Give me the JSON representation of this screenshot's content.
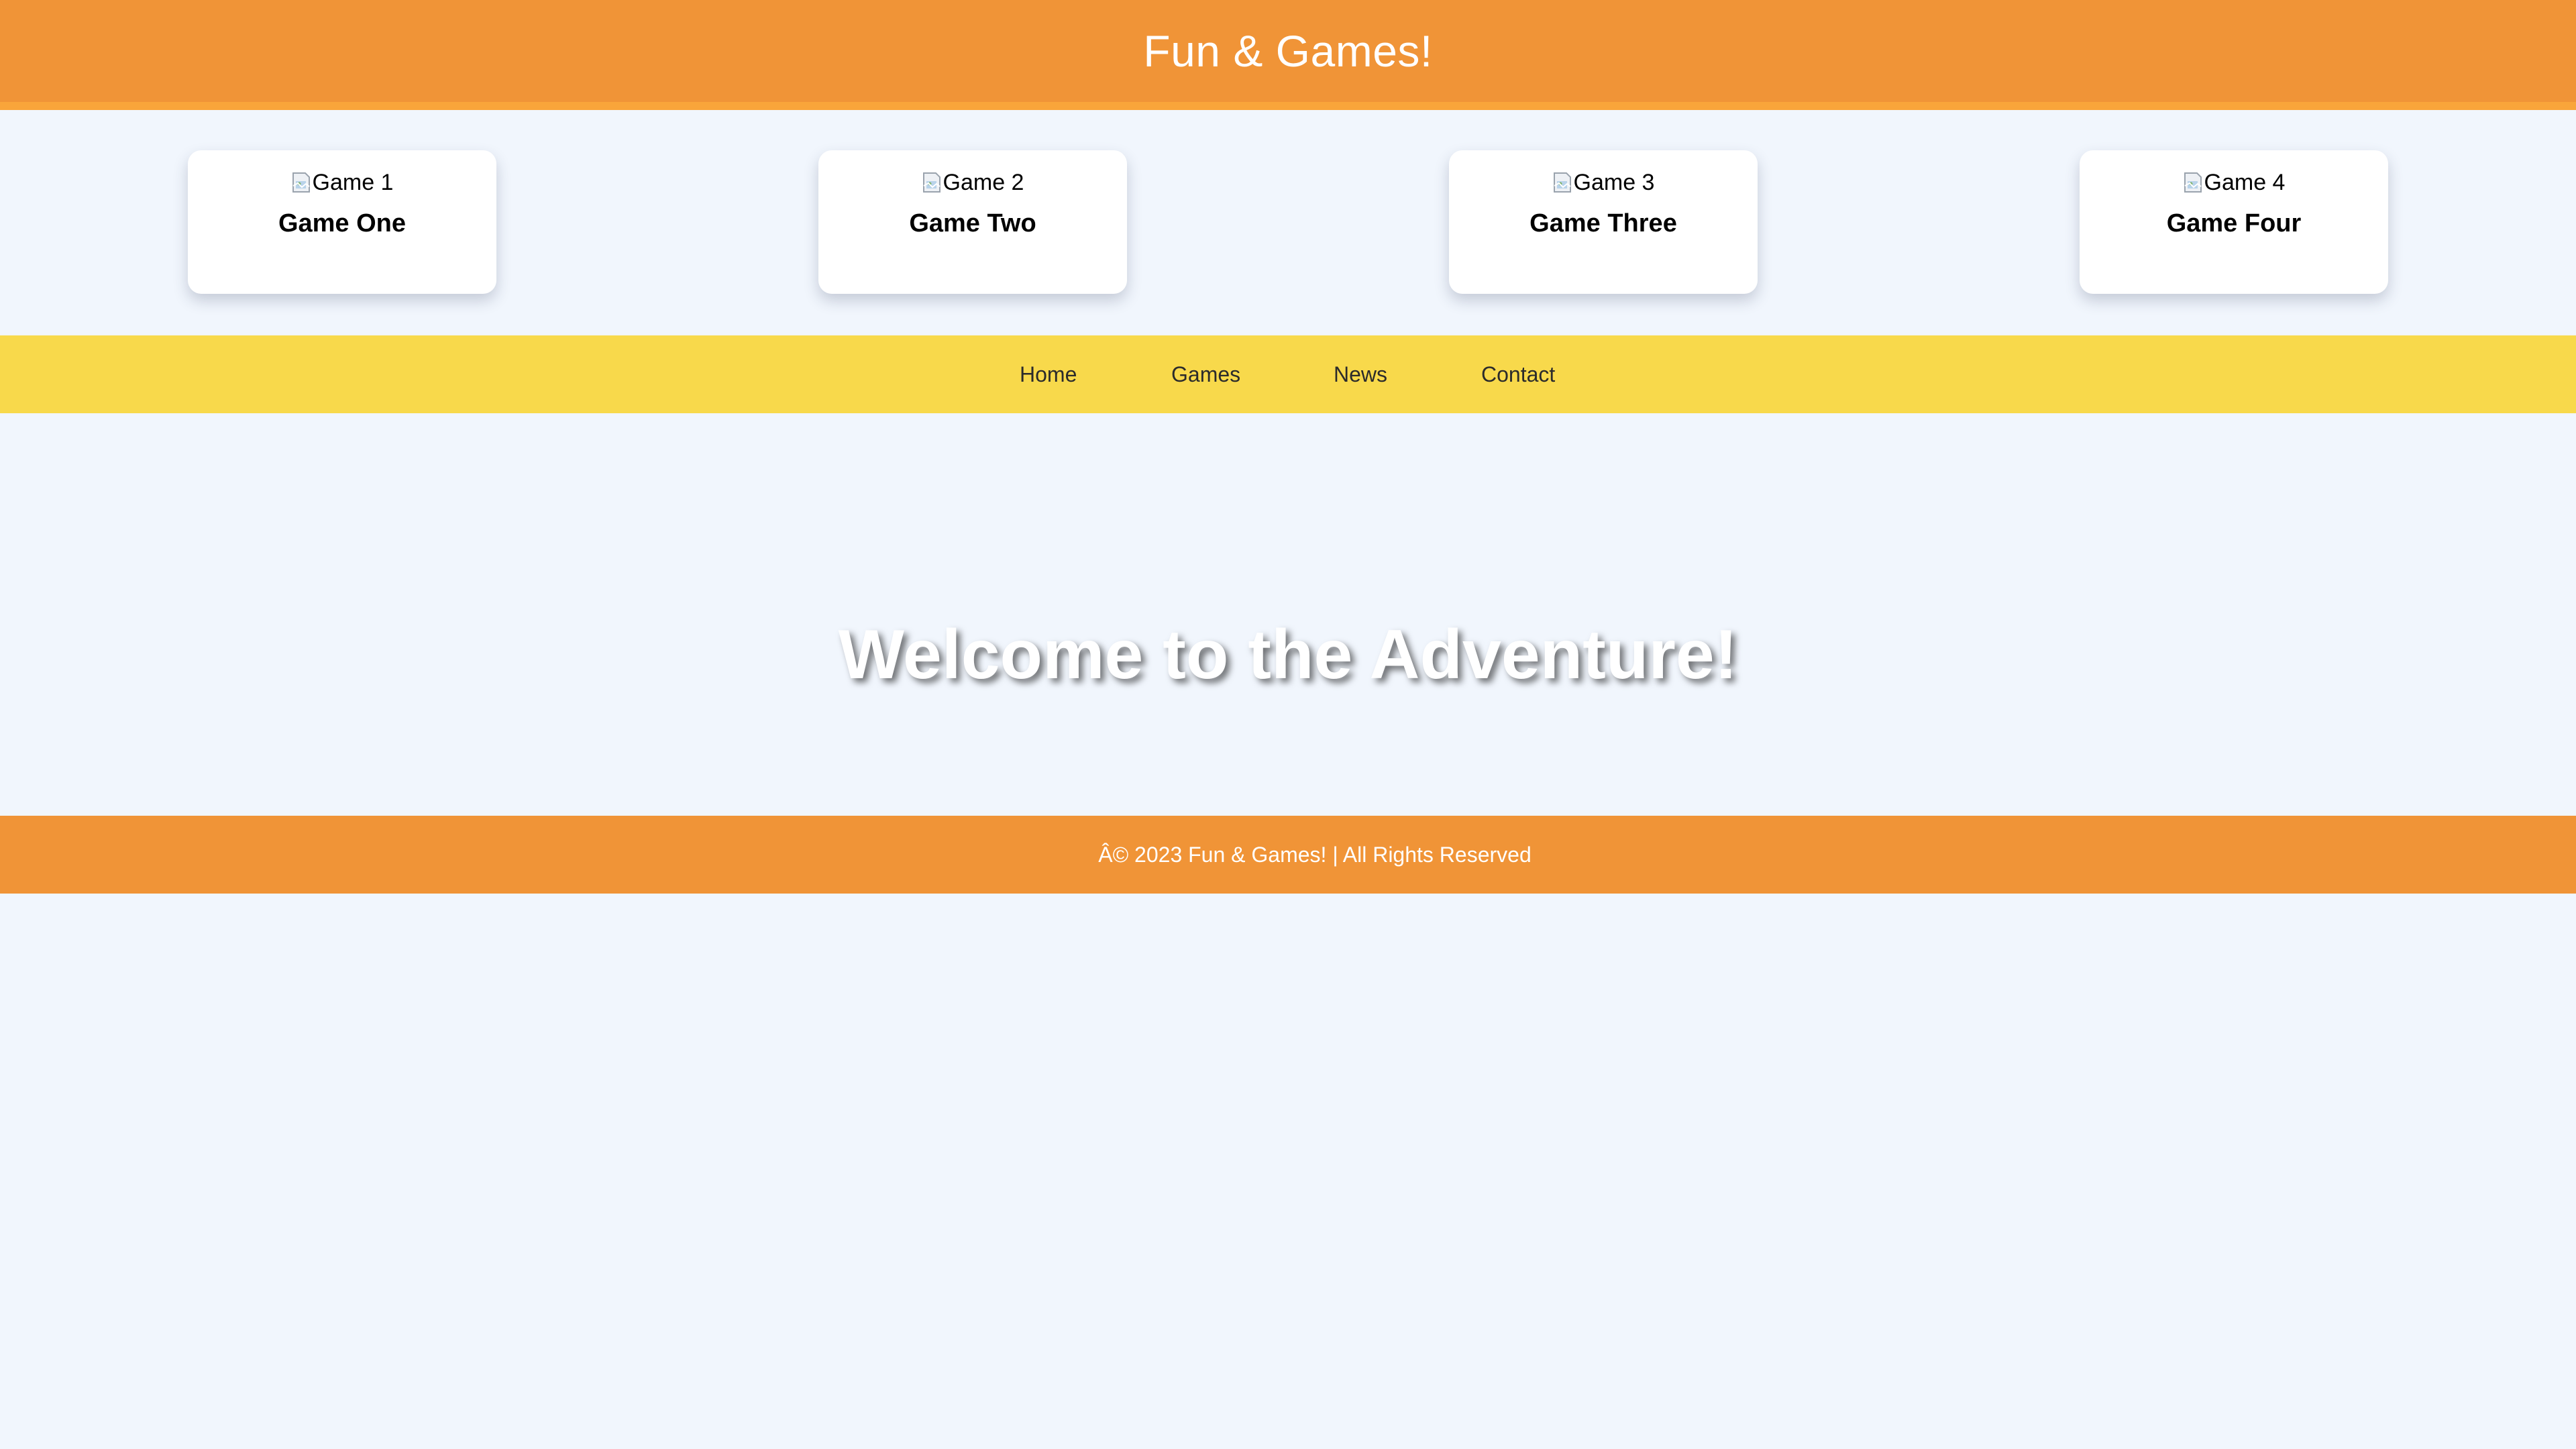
{
  "colors": {
    "header_bg": "#f09437",
    "header_border": "#f9a53a",
    "page_bg": "#f1f6fd",
    "nav_bg": "#f8d94b",
    "footer_bg": "#f09437",
    "card_bg": "#ffffff",
    "hero_text": "#ffffff"
  },
  "header": {
    "title": "Fun & Games!"
  },
  "games": [
    {
      "img_alt": "Game 1",
      "name": "Game One",
      "icon": "broken-image-icon"
    },
    {
      "img_alt": "Game 2",
      "name": "Game Two",
      "icon": "broken-image-icon"
    },
    {
      "img_alt": "Game 3",
      "name": "Game Three",
      "icon": "broken-image-icon"
    },
    {
      "img_alt": "Game 4",
      "name": "Game Four",
      "icon": "broken-image-icon"
    }
  ],
  "nav": {
    "items": [
      {
        "label": "Home"
      },
      {
        "label": "Games"
      },
      {
        "label": "News"
      },
      {
        "label": "Contact"
      }
    ]
  },
  "hero": {
    "title": "Welcome to the Adventure!"
  },
  "footer": {
    "text": "Â© 2023 Fun & Games! | All Rights Reserved"
  }
}
